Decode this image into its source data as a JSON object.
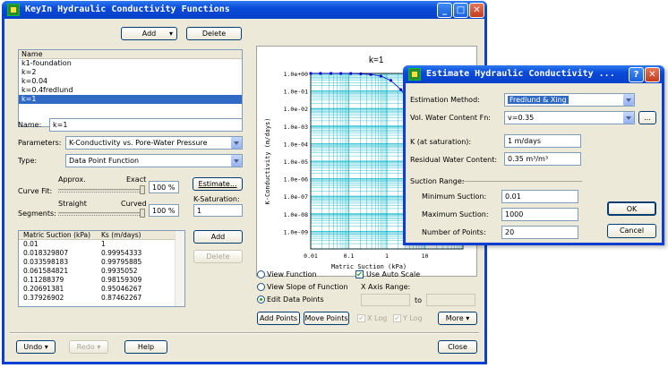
{
  "main_window": {
    "title": "KeyIn Hydraulic Conductivity Functions",
    "controls": {
      "minimize": "_",
      "maximize": "□",
      "close": "✕"
    },
    "add_label": "Add",
    "delete_label": "Delete",
    "list_header": "Name",
    "functions": [
      "k1-foundation",
      "k=2",
      "k=0.04",
      "k=0.4fredlund",
      "k=1"
    ],
    "selected_index": 4,
    "name_label": "Name:",
    "name_value": "k=1",
    "parameters_label": "Parameters:",
    "parameters_value": "K-Conductivity vs. Pore-Water Pressure",
    "type_label": "Type:",
    "type_value": "Data Point Function",
    "curve_fit_label": "Curve Fit:",
    "curve_fit_low": "Approx.",
    "curve_fit_high": "Exact",
    "curve_fit_pct": "100 %",
    "curve_fit_fraction": 1.0,
    "segments_label": "Segments:",
    "segments_low": "Straight",
    "segments_high": "Curved",
    "segments_pct": "100 %",
    "segments_fraction": 1.0,
    "estimate_label": "Estimate...",
    "ksat_label": "K-Saturation:",
    "ksat_value": "1",
    "table_headers": [
      "Matric Suction (kPa)",
      "Ks (m/days)"
    ],
    "table_rows": [
      [
        "0.01",
        "1"
      ],
      [
        "0.018329807",
        "0.99954333"
      ],
      [
        "0.033598183",
        "0.99795885"
      ],
      [
        "0.061584821",
        "0.9935052"
      ],
      [
        "0.11288379",
        "0.98159309"
      ],
      [
        "0.20691381",
        "0.95046267"
      ],
      [
        "0.37926902",
        "0.87462267"
      ]
    ],
    "table_add_label": "Add",
    "table_delete_label": "Delete",
    "view_function_label": "View Function",
    "view_slope_label": "View Slope of Function",
    "edit_points_label": "Edit Data Points",
    "auto_scale_label": "Use Auto Scale",
    "x_axis_range_label": "X Axis Range:",
    "to_label": "to",
    "add_points_label": "Add Points",
    "move_points_label": "Move Points",
    "xlog_label": "X Log",
    "ylog_label": "Y Log",
    "more_label": "More",
    "undo_label": "Undo",
    "redo_label": "Redo",
    "help_label": "Help",
    "close_label": "Close"
  },
  "estimate_dialog": {
    "title": "Estimate Hydraulic Conductivity ...",
    "help_btn": "?",
    "close_btn": "✕",
    "method_label": "Estimation Method:",
    "method_value": "Fredlund & Xing",
    "vwc_label": "Vol. Water Content Fn:",
    "vwc_value": "v=0.35",
    "vwc_browse": "...",
    "k_label": "K (at saturation):",
    "k_value": "1 m/days",
    "residual_label": "Residual Water Content:",
    "residual_value": "0.35 m³/m³",
    "suction_range_label": "Suction Range:",
    "min_label": "Minimum Suction:",
    "min_value": "0.01",
    "max_label": "Maximum Suction:",
    "max_value": "1000",
    "points_label": "Number of Points:",
    "points_value": "20",
    "ok_label": "OK",
    "cancel_label": "Cancel"
  },
  "chart_data": {
    "type": "scatter",
    "title": "k=1",
    "xlabel": "Matric Suction (kPa)",
    "ylabel": "K-Conductivity (m/days)",
    "xscale": "log",
    "yscale": "log",
    "xticks": [
      "0.01",
      "0.1",
      "1",
      "10"
    ],
    "yticks": [
      "1.0e+00",
      "1.0e-01",
      "1.0e-02",
      "1.0e-03",
      "1.0e-04",
      "1.0e-05",
      "1.0e-06",
      "1.0e-07",
      "1.0e-08",
      "1.0e-09"
    ],
    "xlim": [
      0.01,
      100
    ],
    "ylim": [
      1e-10,
      1
    ],
    "grid": true,
    "point_color": "#0000cc",
    "grid_color": "#00b4c8",
    "x": [
      0.01,
      0.018,
      0.034,
      0.062,
      0.113,
      0.207,
      0.379,
      0.695,
      1.27,
      2.33,
      4.28,
      7.85,
      14.4
    ],
    "y": [
      1,
      0.9995,
      0.998,
      0.9935,
      0.9816,
      0.9505,
      0.8746,
      0.7,
      0.4,
      0.12,
      0.02,
      0.002,
      0.0002
    ]
  }
}
